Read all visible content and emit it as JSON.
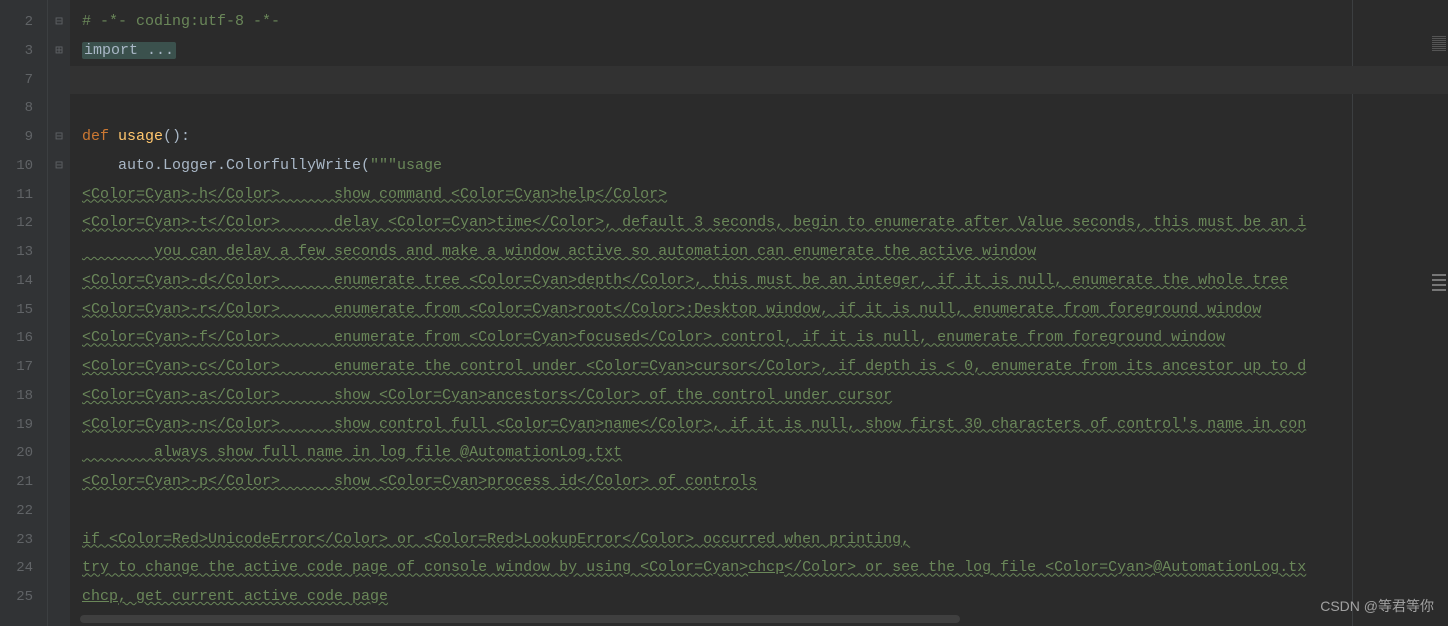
{
  "gutter": {
    "lines": [
      "2",
      "3",
      "7",
      "8",
      "9",
      "10",
      "11",
      "12",
      "13",
      "14",
      "15",
      "16",
      "17",
      "18",
      "19",
      "20",
      "21",
      "22",
      "23",
      "24",
      "25"
    ]
  },
  "fold": {
    "marks": [
      "⊟",
      "⊞",
      "",
      "",
      "⊟",
      "⊟",
      "",
      "",
      "",
      "",
      "",
      "",
      "",
      "",
      "",
      "",
      "",
      "",
      "",
      "",
      ""
    ]
  },
  "code": {
    "l2_comment": "# -*- coding:utf-8 -*-",
    "l3_import": "import ...",
    "l7_blank": "",
    "l8_blank": "",
    "l9_def": "def ",
    "l9_fn": "usage",
    "l9_rest": "():",
    "l10_pre": "    auto.Logger.ColorfullyWrite(",
    "l10_str": "\"\"\"usage",
    "l11": "<Color=Cyan>-h</Color>      show command <Color=Cyan>help</Color>",
    "l12": "<Color=Cyan>-t</Color>      delay <Color=Cyan>time</Color>, default 3 seconds, begin to enumerate after Value seconds, this must be an i",
    "l13": "        you can delay a few seconds and make a window active so automation can enumerate the active window",
    "l14": "<Color=Cyan>-d</Color>      enumerate tree <Color=Cyan>depth</Color>, this must be an integer, if it is null, enumerate the whole tree",
    "l15": "<Color=Cyan>-r</Color>      enumerate from <Color=Cyan>root</Color>:Desktop window, if it is null, enumerate from foreground window",
    "l16": "<Color=Cyan>-f</Color>      enumerate from <Color=Cyan>focused</Color> control, if it is null, enumerate from foreground window",
    "l17": "<Color=Cyan>-c</Color>      enumerate the control under <Color=Cyan>cursor</Color>, if depth is < 0, enumerate from its ancestor up to d",
    "l18": "<Color=Cyan>-a</Color>      show <Color=Cyan>ancestors</Color> of the control under cursor",
    "l19": "<Color=Cyan>-n</Color>      show control full <Color=Cyan>name</Color>, if it is null, show first 30 characters of control's name in con",
    "l20": "        always show full name in log file @AutomationLog.txt",
    "l21": "<Color=Cyan>-p</Color>      show <Color=Cyan>process id</Color> of controls",
    "l22": "",
    "l23": "if <Color=Red>UnicodeError</Color> or <Color=Red>LookupError</Color> occurred when printing,",
    "l24a": "try to change the active code page of console window by using <Color=Cyan>",
    "l24b": "chcp",
    "l24c": "</Color> or see the log file <Color=Cyan>@AutomationLog.tx",
    "l25a": "chcp",
    "l25b": ", get current active code page"
  },
  "watermark": "CSDN @等君等你"
}
